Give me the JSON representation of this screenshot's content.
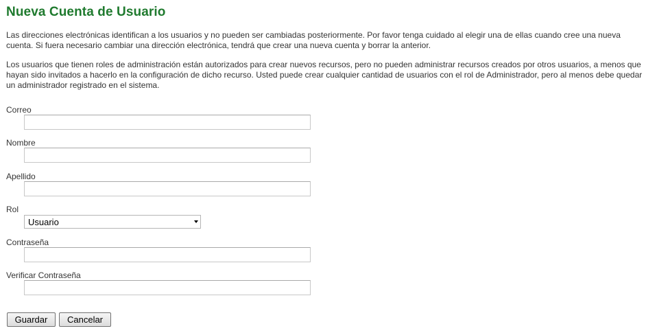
{
  "page": {
    "title": "Nueva Cuenta de Usuario",
    "paragraph1": "Las direcciones electrónicas identifican a los usuarios y no pueden ser cambiadas posteriormente. Por favor tenga cuidado al elegir una de ellas cuando cree una nueva cuenta. Si fuera necesario cambiar una dirección electrónica, tendrá que crear una nueva cuenta y borrar la anterior.",
    "paragraph2": "Los usuarios que tienen roles de administración están autorizados para crear nuevos recursos, pero no pueden administrar recursos creados por otros usuarios, a menos que hayan sido invitados a hacerlo en la configuración de dicho recurso. Usted puede crear cualquier cantidad de usuarios con el rol de Administrador, pero al menos debe quedar un administrador registrado en el sistema."
  },
  "form": {
    "email_label": "Correo",
    "email_value": "",
    "first_name_label": "Nombre",
    "first_name_value": "",
    "last_name_label": "Apellido",
    "last_name_value": "",
    "role_label": "Rol",
    "role_selected": "Usuario",
    "password_label": "Contraseña",
    "password_value": "",
    "confirm_password_label": "Verificar Contraseña",
    "confirm_password_value": ""
  },
  "buttons": {
    "save": "Guardar",
    "cancel": "Cancelar"
  },
  "colors": {
    "title": "#1f7a2e",
    "text": "#333333"
  }
}
